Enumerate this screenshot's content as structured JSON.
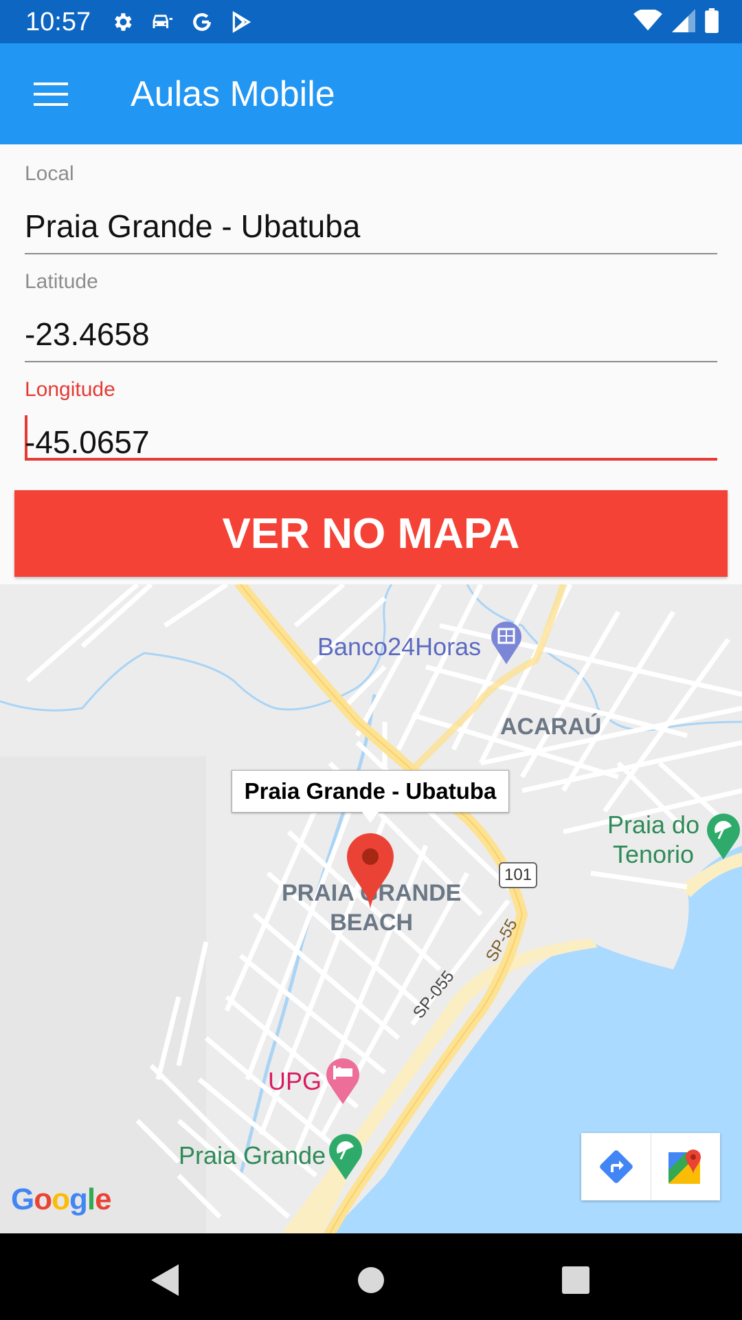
{
  "status_bar": {
    "time": "10:57",
    "left_icons": [
      "gear-icon",
      "car-icon",
      "google-g-icon",
      "play-store-icon"
    ],
    "right_icons": [
      "wifi-icon",
      "signal-icon",
      "battery-icon"
    ]
  },
  "app_bar": {
    "title": "Aulas Mobile",
    "menu_icon": "hamburger-menu-icon"
  },
  "form": {
    "local": {
      "label": "Local",
      "value": "Praia Grande - Ubatuba"
    },
    "latitude": {
      "label": "Latitude",
      "value": "-23.4658"
    },
    "longitude": {
      "label": "Longitude",
      "value": "-45.0657",
      "focused": true
    }
  },
  "button": {
    "label": "VER NO MAPA"
  },
  "map": {
    "info_window": "Praia Grande - Ubatuba",
    "labels": {
      "banco": "Banco24Horas",
      "acarau": "ACARAÚ",
      "beach_line1": "PRAIA GRANDE",
      "beach_line2": "BEACH",
      "tenorio_line1": "Praia do",
      "tenorio_line2": "Tenorio",
      "upg": "UPG",
      "praia_grande": "Praia Grande",
      "route_101": "101",
      "sp055": "SP-055",
      "sp55": "SP-55"
    },
    "google_logo": "Google",
    "toolbar": [
      "directions-icon",
      "google-maps-icon"
    ],
    "colors": {
      "water": "#aadaff",
      "land": "#ececec",
      "road": "#ffffff",
      "highway": "#fde293",
      "beach": "#fbeec2"
    }
  },
  "nav_bar": {
    "buttons": [
      "back-icon",
      "home-icon",
      "recents-icon"
    ]
  }
}
